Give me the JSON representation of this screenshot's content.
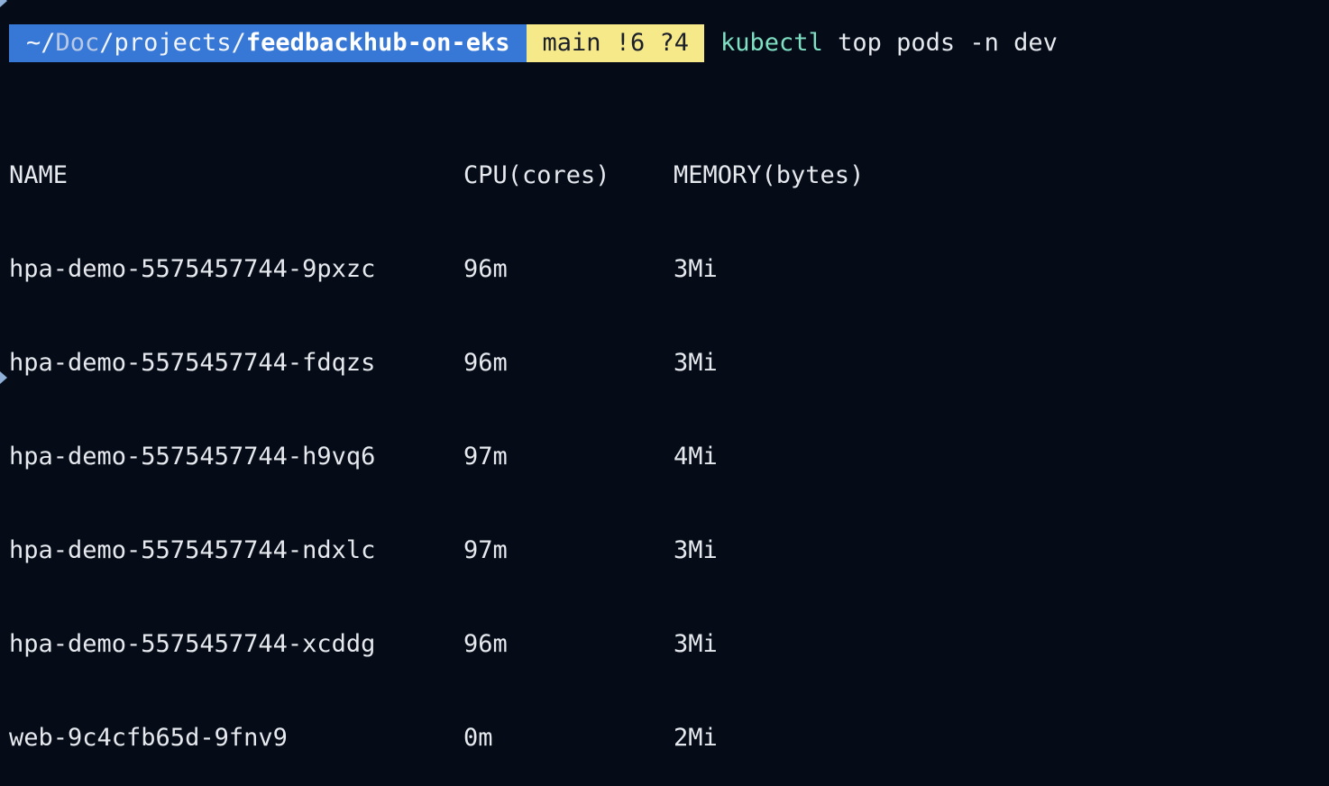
{
  "prompt": {
    "path_prefix": "~/",
    "path_dim": "Doc",
    "path_mid": "/projects/",
    "path_bold": "feedbackhub-on-eks",
    "git_status": "main !6 ?4",
    "command_name": "kubectl",
    "command_args": " top pods -n dev"
  },
  "table": {
    "headers": [
      "NAME",
      "CPU(cores)",
      "MEMORY(bytes)"
    ],
    "rows": [
      [
        "hpa-demo-5575457744-9pxzc",
        "96m",
        "3Mi"
      ],
      [
        "hpa-demo-5575457744-fdqzs",
        "96m",
        "3Mi"
      ],
      [
        "hpa-demo-5575457744-h9vq6",
        "97m",
        "4Mi"
      ],
      [
        "hpa-demo-5575457744-ndxlc",
        "97m",
        "3Mi"
      ],
      [
        "hpa-demo-5575457744-xcddg",
        "96m",
        "3Mi"
      ],
      [
        "web-9c4cfb65d-9fnv9",
        "0m",
        "2Mi"
      ]
    ]
  },
  "colors": {
    "background": "#050c18",
    "path_segment": "#3778d6",
    "git_segment": "#f6e98a",
    "command": "#7fe0c4"
  }
}
